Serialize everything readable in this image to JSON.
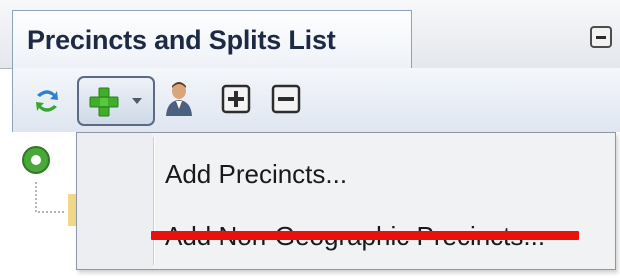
{
  "panel": {
    "title": "Precincts and Splits List"
  },
  "toolbar": {
    "icons": [
      "refresh-icon",
      "add-icon",
      "dropdown-arrow-icon",
      "user-icon",
      "expand-all-icon",
      "collapse-all-icon"
    ]
  },
  "menu": {
    "items": [
      {
        "label": "Add Precincts..."
      },
      {
        "label": "Add Non-Geographic Precincts...",
        "struck_through": true
      }
    ]
  },
  "colors": {
    "strike": "#e8110d",
    "add_green": "#3fae2a",
    "title_text": "#1c2a44"
  }
}
